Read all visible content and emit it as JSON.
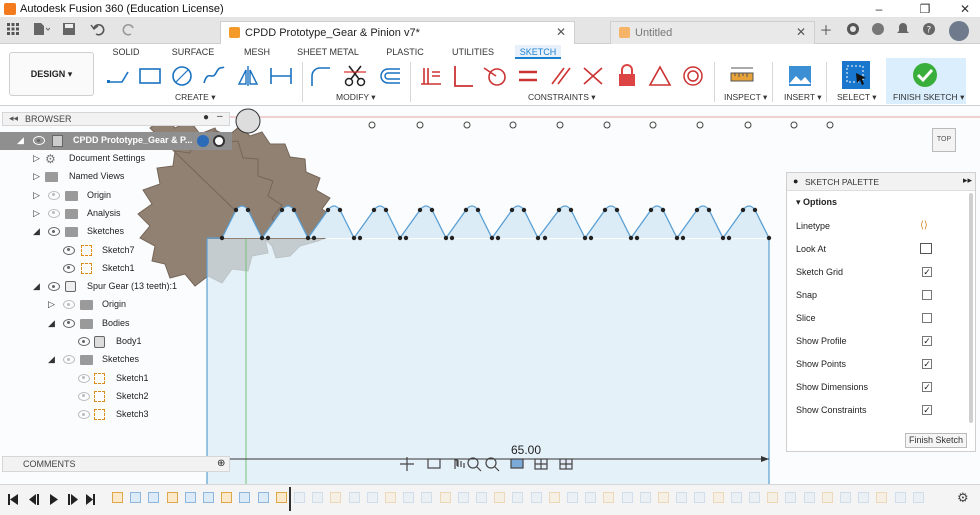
{
  "window": {
    "title": "Autodesk Fusion 360 (Education License)",
    "controls": [
      "–",
      "❐",
      "✕"
    ]
  },
  "tabs": {
    "active_doc": "CPDD Prototype_Gear & Pinion v7*",
    "inactive_doc": "Untitled",
    "close": "✕"
  },
  "ribbon": {
    "workspace": "DESIGN",
    "tabs": [
      "SOLID",
      "SURFACE",
      "MESH",
      "SHEET METAL",
      "PLASTIC",
      "UTILITIES",
      "SKETCH"
    ],
    "groups": {
      "create": "CREATE",
      "modify": "MODIFY",
      "constraints": "CONSTRAINTS",
      "inspect": "INSPECT",
      "insert": "INSERT",
      "select": "SELECT",
      "finish": "FINISH SKETCH"
    }
  },
  "browser": {
    "title": "BROWSER",
    "root": "CPDD Prototype_Gear & P...",
    "items": [
      {
        "label": "Document Settings"
      },
      {
        "label": "Named Views"
      },
      {
        "label": "Origin"
      },
      {
        "label": "Analysis"
      },
      {
        "label": "Sketches"
      },
      {
        "label": "Sketch7"
      },
      {
        "label": "Sketch1"
      },
      {
        "label": "Spur Gear (13 teeth):1"
      },
      {
        "label": "Origin"
      },
      {
        "label": "Bodies"
      },
      {
        "label": "Body1"
      },
      {
        "label": "Sketches"
      },
      {
        "label": "Sketch1"
      },
      {
        "label": "Sketch2"
      },
      {
        "label": "Sketch3"
      }
    ]
  },
  "comments": {
    "title": "COMMENTS"
  },
  "palette": {
    "title": "SKETCH PALETTE",
    "section": "Options",
    "rows": [
      {
        "label": "Linetype"
      },
      {
        "label": "Look At"
      },
      {
        "label": "Sketch Grid",
        "checked": "✓"
      },
      {
        "label": "Snap",
        "checked": ""
      },
      {
        "label": "Slice",
        "checked": ""
      },
      {
        "label": "Show Profile",
        "checked": "✓"
      },
      {
        "label": "Show Points",
        "checked": "✓"
      },
      {
        "label": "Show Dimensions",
        "checked": "✓"
      },
      {
        "label": "Show Constraints",
        "checked": "✓"
      }
    ],
    "finish_button": "Finish Sketch"
  },
  "canvas": {
    "dimension": "65.00",
    "viewcube": "TOP"
  },
  "colors": {
    "accent": "#1a7fcf",
    "profile_fill": "#dcecf7",
    "sketch_line": "#5a9fd4",
    "gear": "#8c7b6b",
    "finish_green": "#3aae3a"
  }
}
